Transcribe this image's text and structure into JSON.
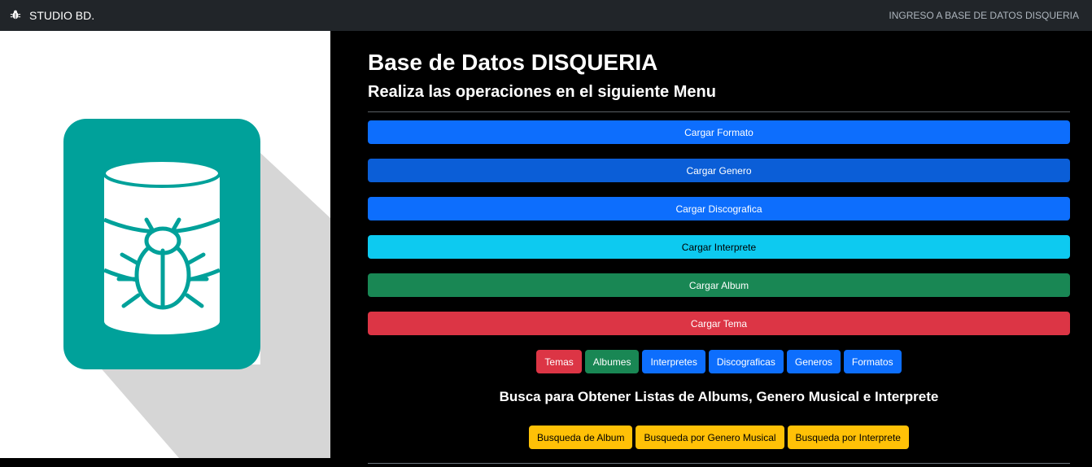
{
  "navbar": {
    "brand_icon": "bug-icon",
    "brand_text": "STUDIO BD.",
    "link_text": "INGRESO A BASE DE DATOS DISQUERIA"
  },
  "hero": {
    "icon": "database-bug-icon",
    "colors": {
      "tile": "#00a19a",
      "shadow": "#d9d9d9"
    }
  },
  "header": {
    "title_prefix": "Base de Datos ",
    "title_strong": "DISQUERIA",
    "subtitle": "Realiza las operaciones en el siguiente Menu"
  },
  "menu_buttons": [
    {
      "label": "Cargar Formato",
      "color": "#0d6efd"
    },
    {
      "label": "Cargar Genero",
      "color": "#0b5ed7"
    },
    {
      "label": "Cargar Discografica",
      "color": "#0d6efd"
    },
    {
      "label": "Cargar Interprete",
      "color": "#0dcaf0"
    },
    {
      "label": "Cargar Album",
      "color": "#198754"
    },
    {
      "label": "Cargar Tema",
      "color": "#dc3545"
    }
  ],
  "list_buttons": [
    {
      "label": "Temas",
      "color": "#dc3545"
    },
    {
      "label": "Albumes",
      "color": "#198754"
    },
    {
      "label": "Interpretes",
      "color": "#0d6efd"
    },
    {
      "label": "Discograficas",
      "color": "#0d6efd"
    },
    {
      "label": "Generos",
      "color": "#0d6efd"
    },
    {
      "label": "Formatos",
      "color": "#0d6efd"
    }
  ],
  "search": {
    "title": "Busca para Obtener Listas de Albums, Genero Musical e Interprete",
    "buttons": [
      {
        "label": "Busqueda de Album",
        "color": "#ffc107"
      },
      {
        "label": "Busqueda por Genero Musical",
        "color": "#ffc107"
      },
      {
        "label": "Busqueda por Interprete",
        "color": "#ffc107"
      }
    ]
  }
}
